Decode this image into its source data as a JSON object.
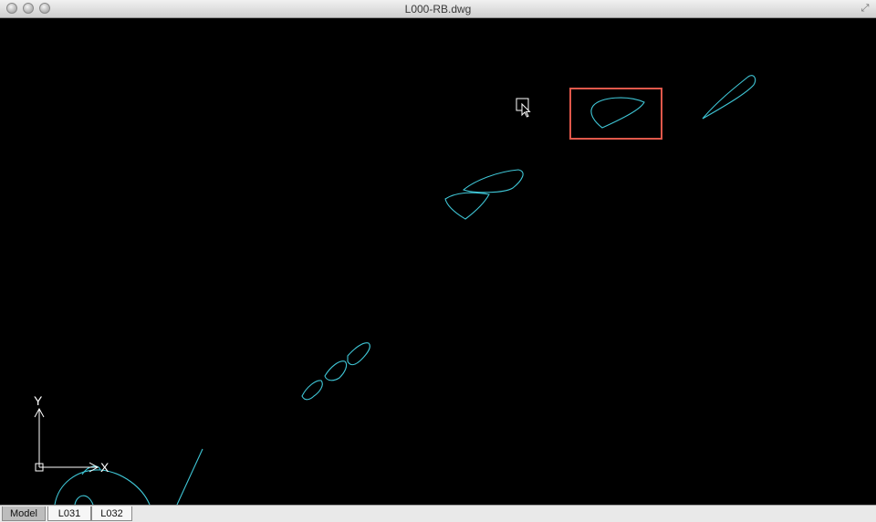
{
  "window": {
    "title": "L000-RB.dwg"
  },
  "tabs": [
    {
      "label": "Model",
      "active": true
    },
    {
      "label": "L031",
      "active": false
    },
    {
      "label": "L032",
      "active": false
    }
  ],
  "ucs": {
    "x_label": "X",
    "y_label": "Y"
  },
  "colors": {
    "geometry": "#3fc6d6",
    "selection_box": "#e0584b",
    "background": "#000000"
  },
  "icons": {
    "cursor": "pick-cursor-icon",
    "fullscreen": "fullscreen-icon"
  }
}
